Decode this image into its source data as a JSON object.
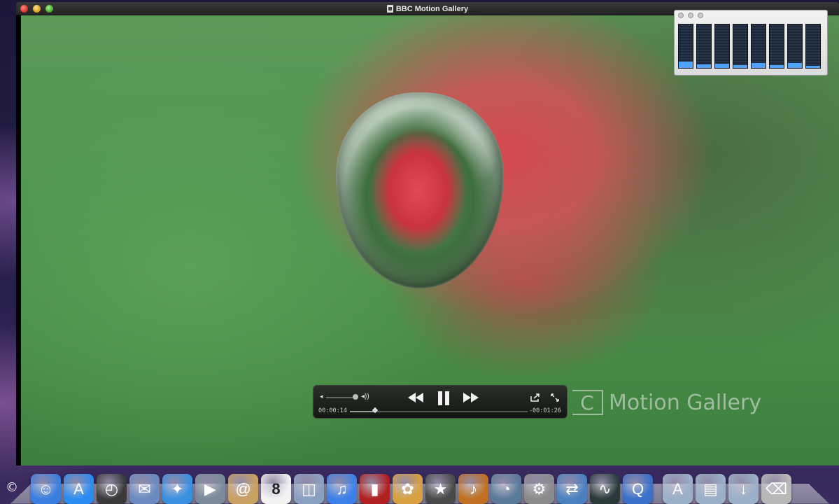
{
  "window": {
    "title": "BBC Motion Gallery"
  },
  "video": {
    "watermark_box": "C",
    "watermark_text": "Motion Gallery"
  },
  "controller": {
    "elapsed": "00:00:14",
    "remaining": "-00:01:26",
    "volume_level": 0.95,
    "progress": 0.14
  },
  "cpu_monitor": {
    "cores": [
      0.15,
      0.08,
      0.1,
      0.07,
      0.12,
      0.06,
      0.12,
      0.05
    ]
  },
  "dock": {
    "apps": [
      {
        "name": "finder-icon",
        "glyph": "☺",
        "color": "#3a7ee0"
      },
      {
        "name": "app-store-icon",
        "glyph": "A",
        "color": "#2a8cf0"
      },
      {
        "name": "dashboard-icon",
        "glyph": "◴",
        "color": "#3a3a3a"
      },
      {
        "name": "mail-stamp-icon",
        "glyph": "✉",
        "color": "#6a8ac0"
      },
      {
        "name": "safari-icon",
        "glyph": "✦",
        "color": "#3a90e0"
      },
      {
        "name": "facetime-icon",
        "glyph": "▶",
        "color": "#7a8a9a"
      },
      {
        "name": "address-book-icon",
        "glyph": "@",
        "color": "#c8a060"
      },
      {
        "name": "ical-icon",
        "glyph": "8",
        "color": "#f2f2f2"
      },
      {
        "name": "preview-icon",
        "glyph": "◫",
        "color": "#8aa0c0"
      },
      {
        "name": "itunes-icon",
        "glyph": "♫",
        "color": "#3a80e8"
      },
      {
        "name": "front-row-icon",
        "glyph": "▮",
        "color": "#b02020"
      },
      {
        "name": "iphoto-icon",
        "glyph": "✿",
        "color": "#d8a040"
      },
      {
        "name": "imovie-icon",
        "glyph": "★",
        "color": "#4a4a4a"
      },
      {
        "name": "garageband-icon",
        "glyph": "♪",
        "color": "#c07020"
      },
      {
        "name": "time-machine-icon",
        "glyph": "◔",
        "color": "#5a7a9a"
      },
      {
        "name": "system-preferences-icon",
        "glyph": "⚙",
        "color": "#8a8a8a"
      },
      {
        "name": "migration-icon",
        "glyph": "⇄",
        "color": "#4a80c0"
      },
      {
        "name": "activity-monitor-icon",
        "glyph": "∿",
        "color": "#2a3a3a"
      },
      {
        "name": "quicktime-icon",
        "glyph": "Q",
        "color": "#3a70c8"
      }
    ],
    "folders": [
      {
        "name": "applications-folder-icon",
        "glyph": "A",
        "color": "#9ab0c8"
      },
      {
        "name": "documents-folder-icon",
        "glyph": "▤",
        "color": "#9ab0c8"
      },
      {
        "name": "downloads-folder-icon",
        "glyph": "↓",
        "color": "#9ab0c8"
      },
      {
        "name": "trash-icon",
        "glyph": "⌫",
        "color": "#b8b8b8"
      }
    ]
  },
  "footer": {
    "copyright": "©"
  }
}
